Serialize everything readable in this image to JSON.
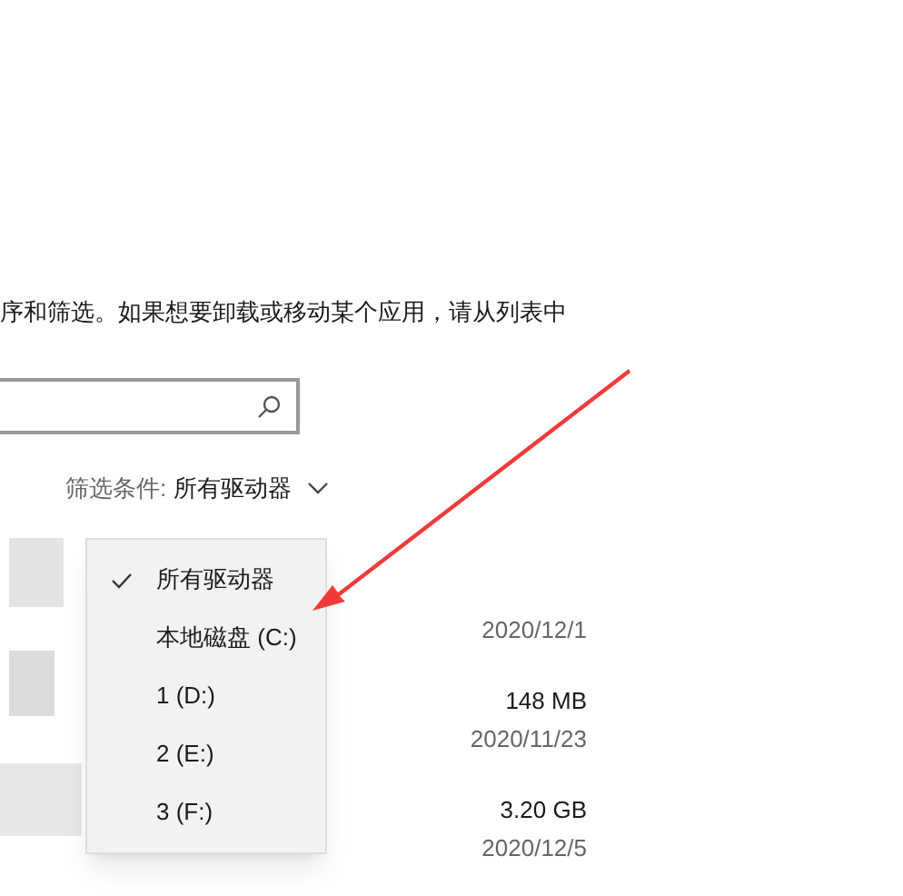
{
  "description": "序和筛选。如果想要卸载或移动某个应用，请从列表中",
  "search": {
    "kind": "search"
  },
  "filter": {
    "label": "筛选条件:",
    "value": "所有驱动器"
  },
  "dropdown": {
    "items": [
      {
        "label": "所有驱动器",
        "selected": true
      },
      {
        "label": "本地磁盘 (C:)",
        "selected": false
      },
      {
        "label": "1 (D:)",
        "selected": false
      },
      {
        "label": "2 (E:)",
        "selected": false
      },
      {
        "label": "3 (F:)",
        "selected": false
      }
    ]
  },
  "apps": [
    {
      "date": "2020/12/1"
    },
    {
      "size": "148 MB",
      "date": "2020/11/23"
    },
    {
      "size": "3.20 GB",
      "date": "2020/12/5"
    }
  ]
}
